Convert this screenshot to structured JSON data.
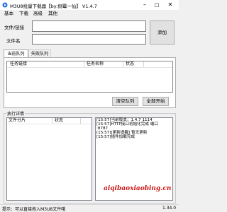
{
  "window": {
    "title": "M3U8批量下载器【by:倒霉一仙】 V1.4.7",
    "minimize": "–",
    "maximize": "□",
    "close": "✕"
  },
  "menu": {
    "items": [
      "基本",
      "下载",
      "高级",
      "其他"
    ]
  },
  "form": {
    "url_label": "文件/链接",
    "name_label": "文件名",
    "url_value": "",
    "name_value": "",
    "add_button": "添加"
  },
  "tabs": {
    "current": "当前队列",
    "failed": "失败队列"
  },
  "queue": {
    "columns": [
      "任务链接",
      "任务名称",
      "状态"
    ],
    "clear_button": "清空队列",
    "start_all_button": "全部开始"
  },
  "details": {
    "section_title": "执行详情",
    "columns": [
      "文件分片",
      "状态"
    ],
    "log_lines": [
      "[15:57]当前版本：1.4.7 1114",
      "[15:57]HTTP接口初始化完成 端口",
      ":8787",
      "[15:57][更新提醒] 暂无更新",
      "[15:57]插件加载完成"
    ]
  },
  "watermark": "aiqibaoxiaobing.cn",
  "status_bar": {
    "hint": "提示：可以直接拖入M3U8文件哦",
    "version": "1.34.0"
  }
}
